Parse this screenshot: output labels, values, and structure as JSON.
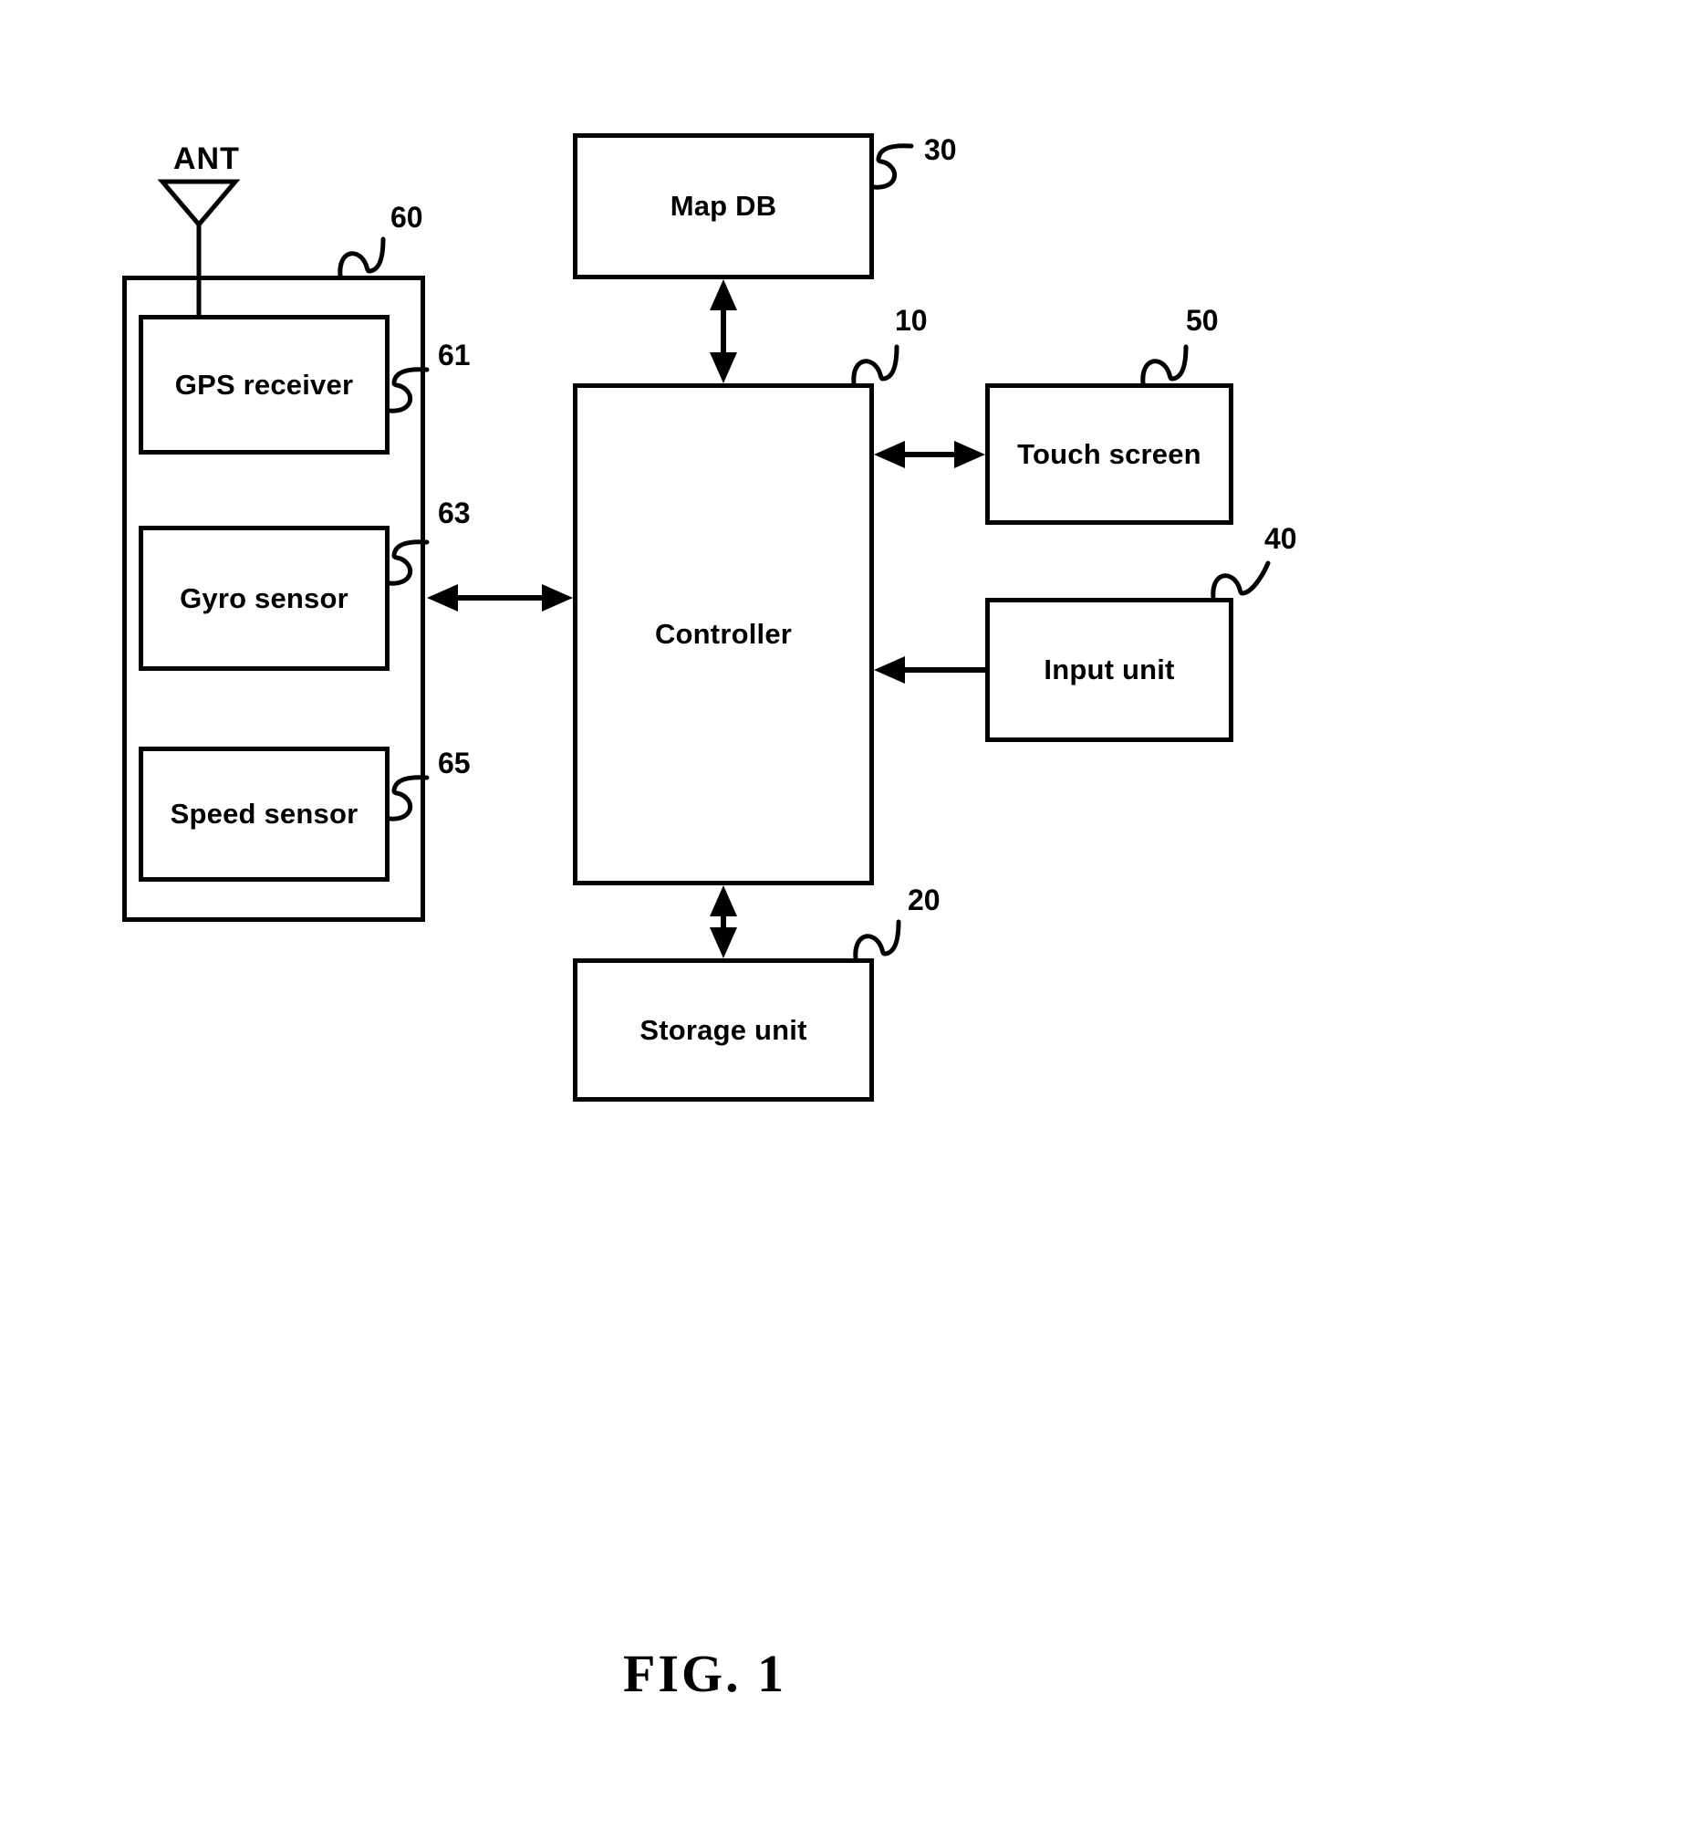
{
  "figure": {
    "caption": "FIG. 1",
    "antenna_label": "ANT",
    "line_color": "#000000",
    "background_color": "#ffffff"
  },
  "blocks": [
    {
      "key": "gps_receiver",
      "label": "GPS receiver",
      "ref": "61"
    },
    {
      "key": "gyro_sensor",
      "label": "Gyro sensor",
      "ref": "63"
    },
    {
      "key": "speed_sensor",
      "label": "Speed sensor",
      "ref": "65"
    },
    {
      "key": "sensor_group",
      "label": "",
      "ref": "60"
    },
    {
      "key": "map_db",
      "label": "Map DB",
      "ref": "30"
    },
    {
      "key": "controller",
      "label": "Controller",
      "ref": "10"
    },
    {
      "key": "touch_screen",
      "label": "Touch screen",
      "ref": "50"
    },
    {
      "key": "input_unit",
      "label": "Input unit",
      "ref": "40"
    },
    {
      "key": "storage_unit",
      "label": "Storage unit",
      "ref": "20"
    }
  ],
  "connections": [
    {
      "from": "map_db",
      "to": "controller",
      "arrow": "double"
    },
    {
      "from": "sensor_group",
      "to": "controller",
      "arrow": "double"
    },
    {
      "from": "controller",
      "to": "touch_screen",
      "arrow": "double"
    },
    {
      "from": "input_unit",
      "to": "controller",
      "arrow": "single"
    },
    {
      "from": "controller",
      "to": "storage_unit",
      "arrow": "double"
    },
    {
      "from": "antenna",
      "to": "gps_receiver",
      "arrow": "none"
    }
  ]
}
